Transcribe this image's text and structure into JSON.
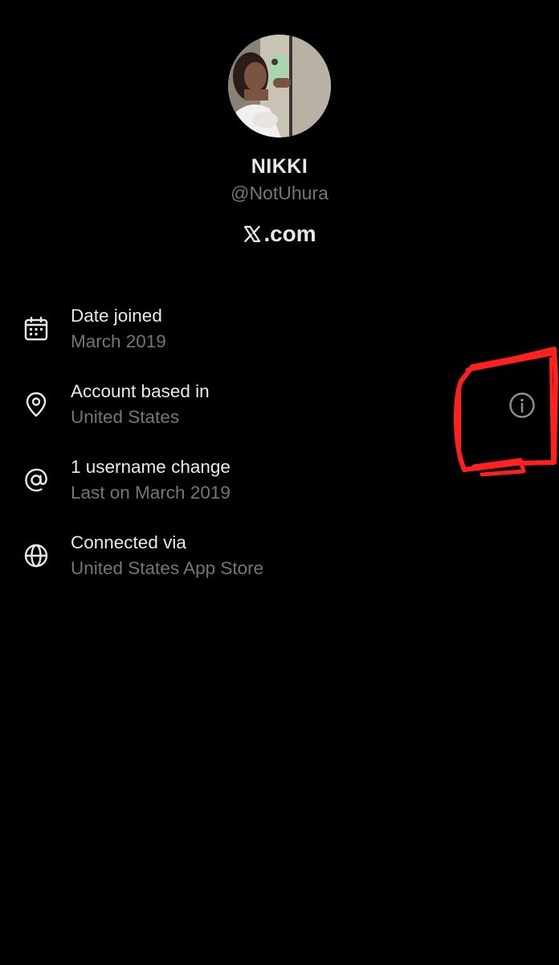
{
  "profile": {
    "display_name": "NIKKI",
    "handle": "@NotUhura",
    "domain": ".com",
    "domain_logo": "x-logo-icon",
    "avatar": "profile-photo-avatar"
  },
  "about": {
    "items": [
      {
        "icon": "calendar-icon",
        "title": "Date joined",
        "subtitle": "March 2019"
      },
      {
        "icon": "location-pin-icon",
        "title": "Account based in",
        "subtitle": "United States"
      },
      {
        "icon": "at-sign-icon",
        "title": "1 username change",
        "subtitle": "Last on March 2019"
      },
      {
        "icon": "globe-icon",
        "title": "Connected via",
        "subtitle": "United States App Store"
      }
    ],
    "info_icon": "info-circle-icon"
  },
  "colors": {
    "background": "#000000",
    "primary_text": "#e7e9ea",
    "secondary_text": "#71767b",
    "annotation": "#ff2020"
  }
}
